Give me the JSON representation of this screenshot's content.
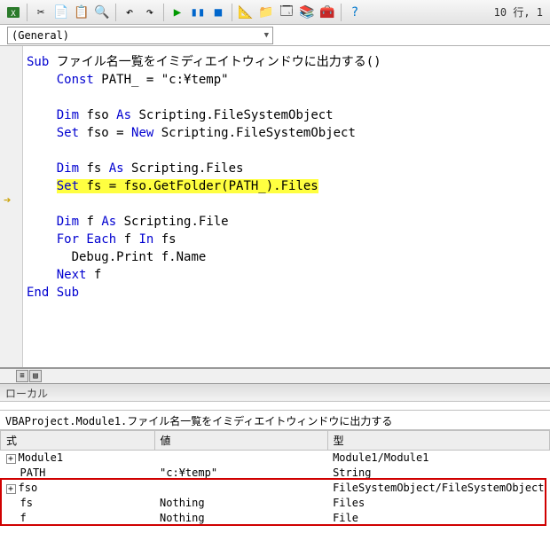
{
  "toolbar": {
    "line_info": "10 行, 1"
  },
  "dropdown": {
    "general": "(General)"
  },
  "code": {
    "sub_kw": "Sub",
    "sub_name": " ファイル名一覧をイミディエイトウィンドウに出力する()",
    "const_kw": "Const",
    "const_line": " PATH_ = \"c:¥temp\"",
    "dim_kw": "Dim",
    "as_kw": "As",
    "set_kw": "Set",
    "new_kw": "New",
    "for_kw": "For Each",
    "in_kw": "In",
    "next_kw": "Next",
    "endsub_kw": "End Sub",
    "fso_decl": " fso ",
    "fso_type": " Scripting.FileSystemObject",
    "fso_set": " fso = ",
    "fs_decl": " fs ",
    "fs_type": " Scripting.Files",
    "fs_set": " fs = fso.GetFolder(PATH_).Files",
    "f_decl": " f ",
    "f_type": " Scripting.File",
    "for_line_a": " f ",
    "for_line_b": " fs",
    "debug_line": "Debug.Print f.Name",
    "next_line": " f"
  },
  "locals": {
    "panel_title": "ローカル",
    "context": "VBAProject.Module1.ファイル名一覧をイミディエイトウィンドウに出力する",
    "col_expr": "式",
    "col_val": "値",
    "col_type": "型",
    "rows": [
      {
        "expr": "Module1",
        "val": "",
        "type": "Module1/Module1",
        "toggle": "+"
      },
      {
        "expr": "PATH_",
        "val": "\"c:¥temp\"",
        "type": "String",
        "toggle": ""
      },
      {
        "expr": "fso",
        "val": "",
        "type": "FileSystemObject/FileSystemObject",
        "toggle": "+"
      },
      {
        "expr": "fs",
        "val": "Nothing",
        "type": "Files",
        "toggle": ""
      },
      {
        "expr": "f",
        "val": "Nothing",
        "type": "File",
        "toggle": ""
      }
    ]
  }
}
